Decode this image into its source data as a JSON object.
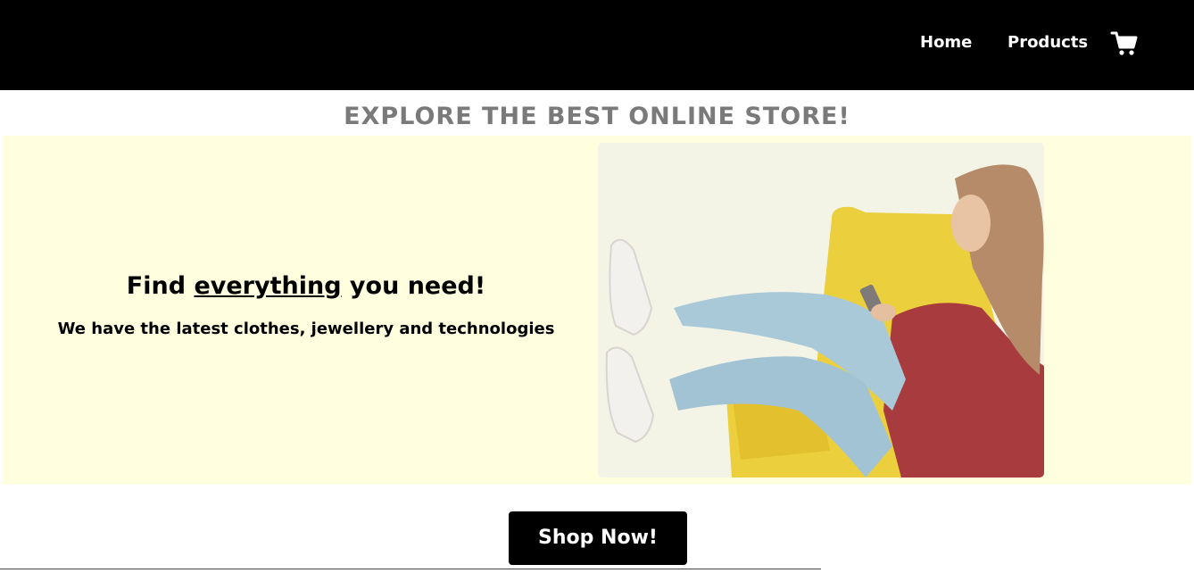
{
  "nav": {
    "home_label": "Home",
    "products_label": "Products",
    "cart_icon": "shopping-cart-icon"
  },
  "headline": "EXPLORE THE BEST ONLINE STORE!",
  "hero": {
    "title_before": "Find ",
    "title_emphasis": "everything",
    "title_after": " you need!",
    "subtitle": "We have the latest clothes, jewellery and technologies",
    "background_color": "#ffffe0"
  },
  "cta": {
    "label": "Shop Now!"
  },
  "colors": {
    "nav_background": "#000000",
    "headline": "#7a7a7a",
    "button_background": "#000000",
    "button_text": "#ffffff"
  }
}
